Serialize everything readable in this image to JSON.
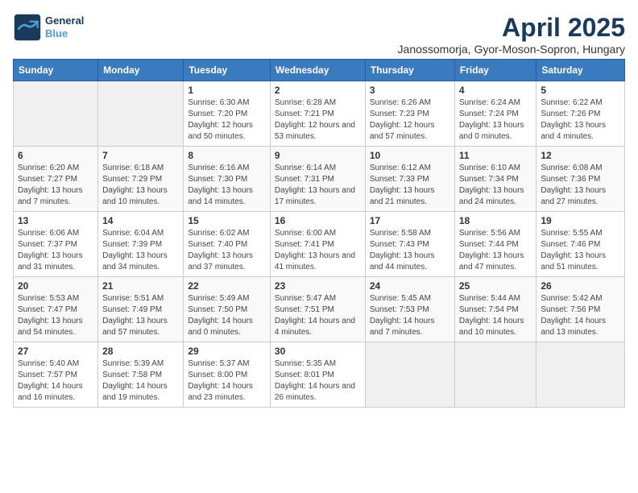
{
  "logo": {
    "line1": "General",
    "line2": "Blue"
  },
  "title": "April 2025",
  "subtitle": "Janossomorja, Gyor-Moson-Sopron, Hungary",
  "headers": [
    "Sunday",
    "Monday",
    "Tuesday",
    "Wednesday",
    "Thursday",
    "Friday",
    "Saturday"
  ],
  "weeks": [
    [
      {
        "day": "",
        "detail": ""
      },
      {
        "day": "",
        "detail": ""
      },
      {
        "day": "1",
        "detail": "Sunrise: 6:30 AM\nSunset: 7:20 PM\nDaylight: 12 hours and 50 minutes."
      },
      {
        "day": "2",
        "detail": "Sunrise: 6:28 AM\nSunset: 7:21 PM\nDaylight: 12 hours and 53 minutes."
      },
      {
        "day": "3",
        "detail": "Sunrise: 6:26 AM\nSunset: 7:23 PM\nDaylight: 12 hours and 57 minutes."
      },
      {
        "day": "4",
        "detail": "Sunrise: 6:24 AM\nSunset: 7:24 PM\nDaylight: 13 hours and 0 minutes."
      },
      {
        "day": "5",
        "detail": "Sunrise: 6:22 AM\nSunset: 7:26 PM\nDaylight: 13 hours and 4 minutes."
      }
    ],
    [
      {
        "day": "6",
        "detail": "Sunrise: 6:20 AM\nSunset: 7:27 PM\nDaylight: 13 hours and 7 minutes."
      },
      {
        "day": "7",
        "detail": "Sunrise: 6:18 AM\nSunset: 7:29 PM\nDaylight: 13 hours and 10 minutes."
      },
      {
        "day": "8",
        "detail": "Sunrise: 6:16 AM\nSunset: 7:30 PM\nDaylight: 13 hours and 14 minutes."
      },
      {
        "day": "9",
        "detail": "Sunrise: 6:14 AM\nSunset: 7:31 PM\nDaylight: 13 hours and 17 minutes."
      },
      {
        "day": "10",
        "detail": "Sunrise: 6:12 AM\nSunset: 7:33 PM\nDaylight: 13 hours and 21 minutes."
      },
      {
        "day": "11",
        "detail": "Sunrise: 6:10 AM\nSunset: 7:34 PM\nDaylight: 13 hours and 24 minutes."
      },
      {
        "day": "12",
        "detail": "Sunrise: 6:08 AM\nSunset: 7:36 PM\nDaylight: 13 hours and 27 minutes."
      }
    ],
    [
      {
        "day": "13",
        "detail": "Sunrise: 6:06 AM\nSunset: 7:37 PM\nDaylight: 13 hours and 31 minutes."
      },
      {
        "day": "14",
        "detail": "Sunrise: 6:04 AM\nSunset: 7:39 PM\nDaylight: 13 hours and 34 minutes."
      },
      {
        "day": "15",
        "detail": "Sunrise: 6:02 AM\nSunset: 7:40 PM\nDaylight: 13 hours and 37 minutes."
      },
      {
        "day": "16",
        "detail": "Sunrise: 6:00 AM\nSunset: 7:41 PM\nDaylight: 13 hours and 41 minutes."
      },
      {
        "day": "17",
        "detail": "Sunrise: 5:58 AM\nSunset: 7:43 PM\nDaylight: 13 hours and 44 minutes."
      },
      {
        "day": "18",
        "detail": "Sunrise: 5:56 AM\nSunset: 7:44 PM\nDaylight: 13 hours and 47 minutes."
      },
      {
        "day": "19",
        "detail": "Sunrise: 5:55 AM\nSunset: 7:46 PM\nDaylight: 13 hours and 51 minutes."
      }
    ],
    [
      {
        "day": "20",
        "detail": "Sunrise: 5:53 AM\nSunset: 7:47 PM\nDaylight: 13 hours and 54 minutes."
      },
      {
        "day": "21",
        "detail": "Sunrise: 5:51 AM\nSunset: 7:49 PM\nDaylight: 13 hours and 57 minutes."
      },
      {
        "day": "22",
        "detail": "Sunrise: 5:49 AM\nSunset: 7:50 PM\nDaylight: 14 hours and 0 minutes."
      },
      {
        "day": "23",
        "detail": "Sunrise: 5:47 AM\nSunset: 7:51 PM\nDaylight: 14 hours and 4 minutes."
      },
      {
        "day": "24",
        "detail": "Sunrise: 5:45 AM\nSunset: 7:53 PM\nDaylight: 14 hours and 7 minutes."
      },
      {
        "day": "25",
        "detail": "Sunrise: 5:44 AM\nSunset: 7:54 PM\nDaylight: 14 hours and 10 minutes."
      },
      {
        "day": "26",
        "detail": "Sunrise: 5:42 AM\nSunset: 7:56 PM\nDaylight: 14 hours and 13 minutes."
      }
    ],
    [
      {
        "day": "27",
        "detail": "Sunrise: 5:40 AM\nSunset: 7:57 PM\nDaylight: 14 hours and 16 minutes."
      },
      {
        "day": "28",
        "detail": "Sunrise: 5:39 AM\nSunset: 7:58 PM\nDaylight: 14 hours and 19 minutes."
      },
      {
        "day": "29",
        "detail": "Sunrise: 5:37 AM\nSunset: 8:00 PM\nDaylight: 14 hours and 23 minutes."
      },
      {
        "day": "30",
        "detail": "Sunrise: 5:35 AM\nSunset: 8:01 PM\nDaylight: 14 hours and 26 minutes."
      },
      {
        "day": "",
        "detail": ""
      },
      {
        "day": "",
        "detail": ""
      },
      {
        "day": "",
        "detail": ""
      }
    ]
  ]
}
